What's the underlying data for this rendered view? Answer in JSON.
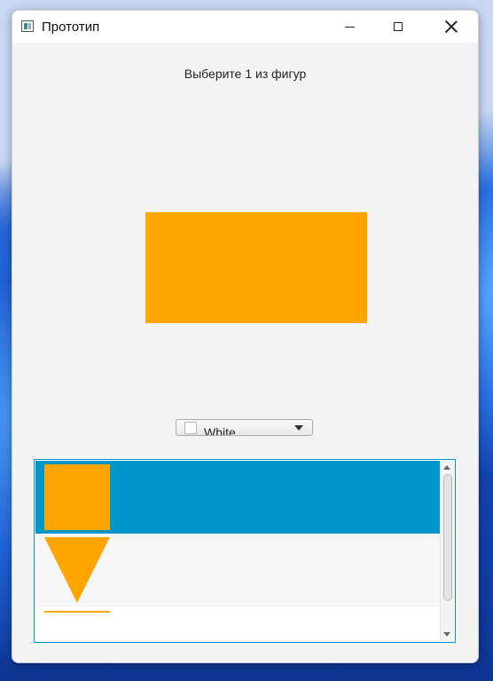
{
  "window": {
    "title": "Прототип"
  },
  "prompt": "Выберите 1 из фигур",
  "preview": {
    "shape": "rectangle",
    "color": "#ffa500"
  },
  "color_picker": {
    "selected": "White",
    "swatch_color": "#ffffff"
  },
  "shape_list": {
    "items": [
      {
        "shape": "square",
        "color": "#ffa500",
        "selected": true
      },
      {
        "shape": "triangle",
        "color": "#ffa500",
        "selected": false
      },
      {
        "shape": "line",
        "color": "#ffa500",
        "selected": false
      }
    ],
    "selection_color": "#0096c9"
  }
}
